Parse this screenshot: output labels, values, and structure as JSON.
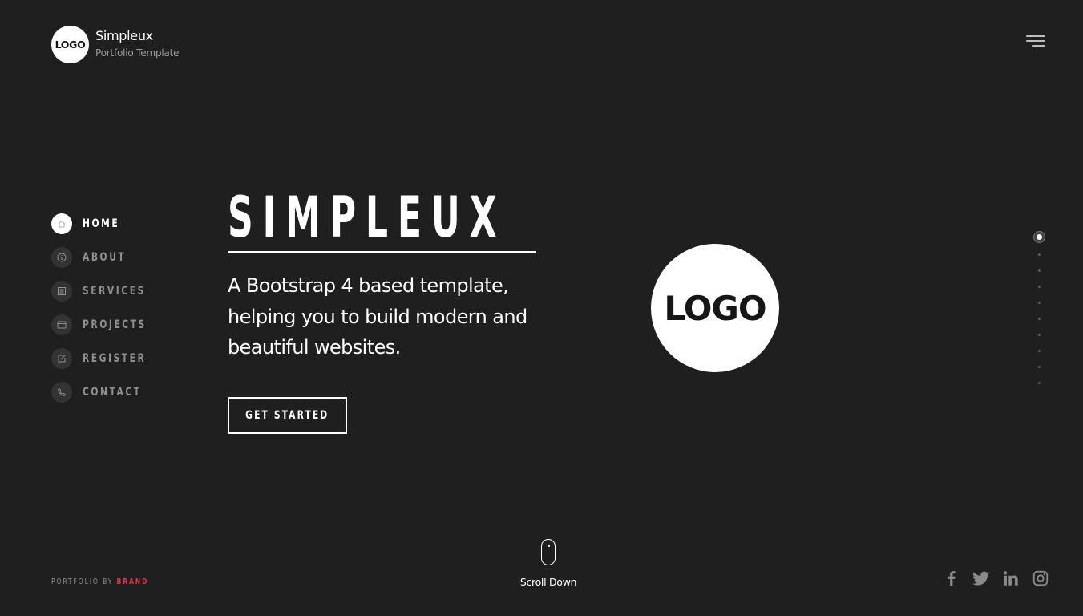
{
  "header": {
    "logo_text": "LOGO",
    "site_name": "Simpleux",
    "tagline": "Portfolio Template",
    "menu_icon": "hamburger-menu-icon"
  },
  "sidebar": {
    "items": [
      {
        "label": "HOME",
        "icon": "home-icon",
        "active": true
      },
      {
        "label": "ABOUT",
        "icon": "info-icon",
        "active": false
      },
      {
        "label": "SERVICES",
        "icon": "list-icon",
        "active": false
      },
      {
        "label": "PROJECTS",
        "icon": "browser-window-icon",
        "active": false
      },
      {
        "label": "REGISTER",
        "icon": "edit-icon",
        "active": false
      },
      {
        "label": "CONTACT",
        "icon": "phone-icon",
        "active": false
      }
    ]
  },
  "hero": {
    "title": "SIMPLEUX",
    "lead": "A Bootstrap 4 based template, helping you to build modern and beautiful websites.",
    "cta_label": "GET STARTED",
    "logo_text": "LOGO"
  },
  "pagination": {
    "total": 10,
    "active_index": 0
  },
  "footer": {
    "credit_prefix": "PORTFOLIO BY ",
    "credit_brand": "BRAND",
    "brand_color": "#e0314b",
    "scroll_label": "Scroll Down",
    "social": [
      {
        "name": "facebook",
        "icon": "facebook-icon"
      },
      {
        "name": "twitter",
        "icon": "twitter-icon"
      },
      {
        "name": "linkedin",
        "icon": "linkedin-icon"
      },
      {
        "name": "instagram",
        "icon": "instagram-icon"
      }
    ]
  }
}
